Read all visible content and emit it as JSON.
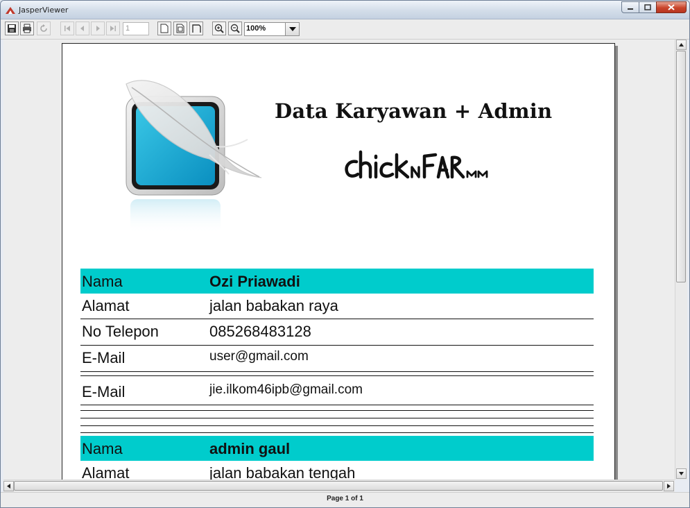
{
  "window": {
    "title": "JasperViewer"
  },
  "toolbar": {
    "page_number_placeholder": "1",
    "zoom_value": "100%"
  },
  "status": {
    "page_label": "Page 1 of 1"
  },
  "report": {
    "title": "Data Karyawan + Admin",
    "records": [
      {
        "nama_label": "Nama",
        "nama": "Ozi Priawadi",
        "alamat_label": "Alamat",
        "alamat": "jalan babakan raya",
        "telepon_label": "No Telepon",
        "telepon": "085268483128",
        "email_label": "E-Mail",
        "email": "user@gmail.com",
        "email2_label": "E-Mail",
        "email2": "jie.ilkom46ipb@gmail.com"
      },
      {
        "nama_label": "Nama",
        "nama": "admin gaul",
        "alamat_label": "Alamat",
        "alamat": "jalan babakan tengah"
      }
    ],
    "band_color": "#00cccc"
  }
}
